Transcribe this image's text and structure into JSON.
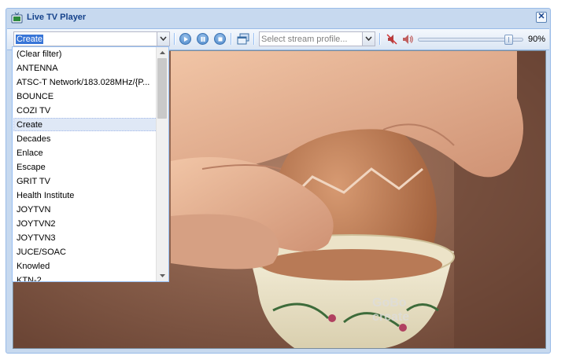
{
  "window": {
    "title": "Live TV Player",
    "close_icon": "close-icon"
  },
  "toolbar": {
    "channel_combo": {
      "value": "Create"
    },
    "profile_combo": {
      "placeholder": "Select stream profile..."
    },
    "buttons": [
      "play-icon",
      "pause-icon",
      "stop-icon",
      "popout-window-icon",
      "mute-icon",
      "volume-icon"
    ],
    "volume": {
      "level": 0.9,
      "label": "90%"
    }
  },
  "dropdown": {
    "items": [
      "(Clear filter)",
      "ANTENNA",
      "ATSC-T Network/183.028MHz/{P...",
      "BOUNCE",
      "COZI TV",
      "Create",
      "Decades",
      "Enlace",
      "Escape",
      "GRIT TV",
      "Health Institute",
      "JOYTVN",
      "JOYTVN2",
      "JOYTVN3",
      "JUCE/SOAC",
      "Knowled",
      "KTN-2"
    ],
    "selected": "Create"
  },
  "video": {
    "watermark_line1": "GoBo",
    "watermark_line2": "create"
  },
  "colors": {
    "accent": "#15428b",
    "window_bg": "#c7d9ef",
    "selected_row": "#dfe8f6"
  }
}
